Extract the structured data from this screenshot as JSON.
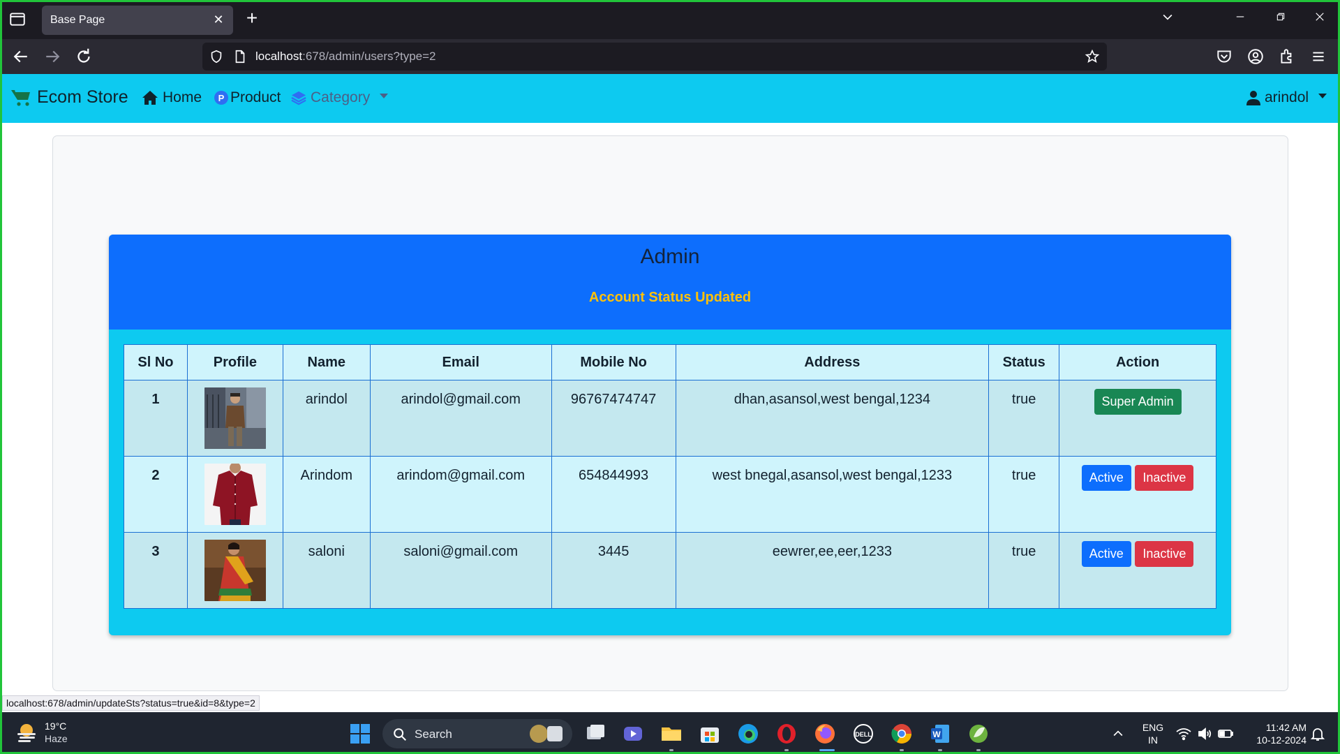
{
  "browser": {
    "tab_title": "Base Page",
    "url_host": "localhost",
    "url_path": ":678/admin/users?type=2",
    "status_url": "localhost:678/admin/updateSts?status=true&id=8&type=2"
  },
  "nav": {
    "brand": "Ecom Store",
    "home": "Home",
    "product": "Product",
    "category": "Category",
    "user": "arindol"
  },
  "page": {
    "title": "Admin",
    "message": "Account Status Updated"
  },
  "table": {
    "headers": [
      "Sl No",
      "Profile",
      "Name",
      "Email",
      "Mobile No",
      "Address",
      "Status",
      "Action"
    ],
    "rows": [
      {
        "sl": "1",
        "profile": "man-jacket-photo",
        "name": "arindol",
        "email": "arindol@gmail.com",
        "mobile": "96767474747",
        "address": "dhan,asansol,west bengal,1234",
        "status": "true",
        "actions": [
          "Super Admin"
        ]
      },
      {
        "sl": "2",
        "profile": "red-shirt-photo",
        "name": "Arindom",
        "email": "arindom@gmail.com",
        "mobile": "654844993",
        "address": "west bnegal,asansol,west bengal,1233",
        "status": "true",
        "actions": [
          "Active",
          "Inactive"
        ]
      },
      {
        "sl": "3",
        "profile": "saree-photo",
        "name": "saloni",
        "email": "saloni@gmail.com",
        "mobile": "3445",
        "address": "eewrer,ee,eer,1233",
        "status": "true",
        "actions": [
          "Active",
          "Inactive"
        ]
      }
    ]
  },
  "taskbar": {
    "temperature": "19°C",
    "weather": "Haze",
    "search": "Search",
    "lang": "ENG",
    "region": "IN",
    "time": "11:42 AM",
    "date": "10-12-2024"
  },
  "colors": {
    "navbar": "#0dcaf0",
    "header": "#0d6efd",
    "message": "#ffc107",
    "super_admin": "#198754",
    "active": "#0d6efd",
    "inactive": "#dc3545"
  }
}
